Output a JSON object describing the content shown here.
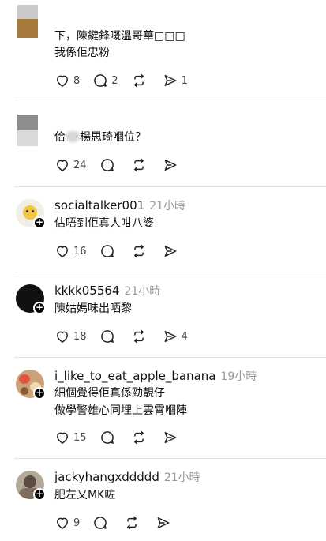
{
  "comments": [
    {
      "username": "",
      "time": "",
      "lines": [
        "下，陳鍵鋒嘅溫哥華□□□",
        "我係佢忠粉"
      ],
      "likes": "8",
      "replies": "2",
      "reposts": "",
      "shares": "1",
      "avatar": "pixelated-avatar-brown"
    },
    {
      "username": "",
      "time": "",
      "line_prefix": "佮",
      "line_suffix": "楊思琦嗰位？",
      "likes": "24",
      "replies": "",
      "reposts": "",
      "shares": "",
      "avatar": "pixelated-avatar-gray"
    },
    {
      "username": "socialtalker001",
      "time": "21小時",
      "lines": [
        "估唔到佢真人咁八婆"
      ],
      "likes": "16",
      "replies": "",
      "reposts": "",
      "shares": "",
      "avatar": "cartoon-avatar-yellow"
    },
    {
      "username": "kkkk05564",
      "time": "21小時",
      "lines": [
        "陳姑媽味出哂黎"
      ],
      "likes": "18",
      "replies": "",
      "reposts": "",
      "shares": "4",
      "avatar": "black-avatar"
    },
    {
      "username": "i_like_to_eat_apple_banana",
      "time": "19小時",
      "lines": [
        "細個覺得佢真係勁靚仔",
        "做學警雄心同埋上雲霄嗰陣"
      ],
      "likes": "15",
      "replies": "",
      "reposts": "",
      "shares": "",
      "avatar": "food-avatar"
    },
    {
      "username": "jackyhangxddddd",
      "time": "21小時",
      "lines": [
        "肥左又MK咗"
      ],
      "likes": "9",
      "replies": "",
      "reposts": "",
      "shares": "",
      "avatar": "photo-avatar"
    }
  ],
  "colors": {
    "text": "#101010",
    "muted": "#999999",
    "divider": "#e3e3e3",
    "icon": "#222222"
  }
}
